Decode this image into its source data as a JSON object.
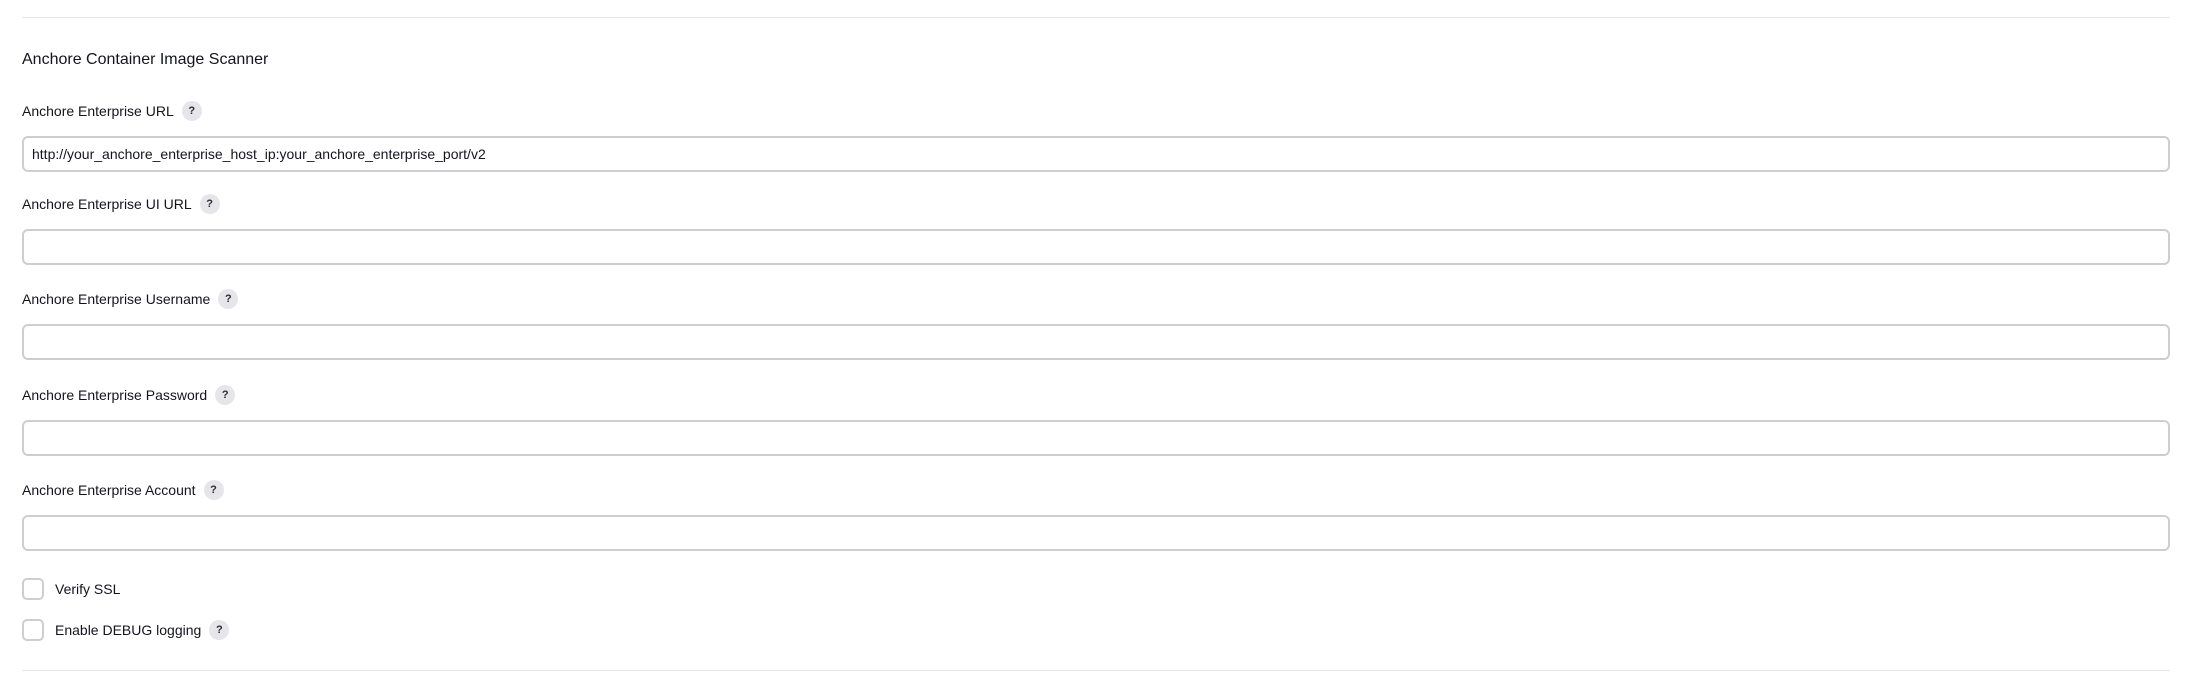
{
  "section": {
    "title": "Anchore Container Image Scanner"
  },
  "fields": [
    {
      "label": "Anchore Enterprise URL",
      "value": "http://your_anchore_enterprise_host_ip:your_anchore_enterprise_port/v2",
      "placeholder": ""
    },
    {
      "label": "Anchore Enterprise UI URL",
      "value": "",
      "placeholder": ""
    },
    {
      "label": "Anchore Enterprise Username",
      "value": "",
      "placeholder": ""
    },
    {
      "label": "Anchore Enterprise Password",
      "value": "",
      "placeholder": ""
    },
    {
      "label": "Anchore Enterprise Account",
      "value": "",
      "placeholder": ""
    }
  ],
  "checkboxes": [
    {
      "label": "Verify SSL",
      "checked": false,
      "has_help": false
    },
    {
      "label": "Enable DEBUG logging",
      "checked": false,
      "has_help": true
    }
  ],
  "help_icon_glyph": "?",
  "icons": {
    "help": "help-question-icon"
  },
  "colors": {
    "border": "#cdcdd4",
    "divider": "#e6e6ea",
    "help_bg": "#e6e6ea",
    "text": "#14141f"
  }
}
